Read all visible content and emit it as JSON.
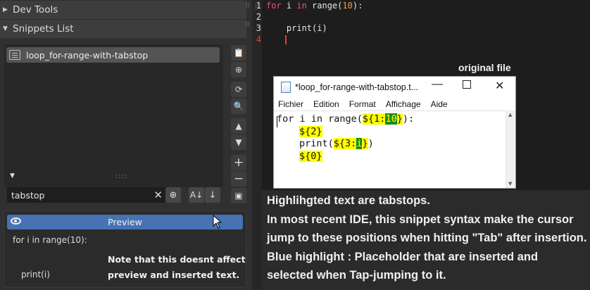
{
  "left_panel": {
    "dev_tools_header": "Dev Tools",
    "snippets_header": "Snippets List",
    "list_items": [
      "loop_for-range-with-tabstop"
    ],
    "search_value": "tabstop",
    "preview_label": "Preview",
    "preview_lines": [
      "for i in range(10):",
      "print(i)"
    ],
    "preview_note": "Note that this doesnt affect preview and inserted text."
  },
  "editor": {
    "line_numbers": [
      "1",
      "2",
      "3",
      "4"
    ],
    "line1": {
      "kw1": "for",
      "var": " i ",
      "kw2": "in",
      "fn": " range(",
      "num": "10",
      "end": "):"
    },
    "line3": "    print(i)"
  },
  "notepad": {
    "label": "original file",
    "title": "*loop_for-range-with-tabstop.t...",
    "menu": [
      "Fichier",
      "Edition",
      "Format",
      "Affichage",
      "Aide"
    ],
    "line1": {
      "pre": "for i in range(",
      "tab1_open": "${1:",
      "tab1_val": "10",
      "tab1_close": "}",
      "post": "):"
    },
    "line2": "${2}",
    "line3": {
      "pre": "print(",
      "tab3_open": "${3:",
      "tab3_val": "i",
      "tab3_close": "}",
      "post": ")"
    },
    "line4": "${0}"
  },
  "explanation": [
    "Highlihgted text are tabstops.",
    "In most recent IDE, this snippet syntax make the cursor jump to these positions when hitting \"Tab\" after insertion.",
    "Blue highlight : Placeholder that are inserted and selected when Tap-jumping to it."
  ],
  "colors": {
    "accent_blue": "#4772b3",
    "tabstop_yellow": "#ffff00",
    "tabstop_green": "#1a8a1a",
    "caret_red": "#e04040"
  }
}
